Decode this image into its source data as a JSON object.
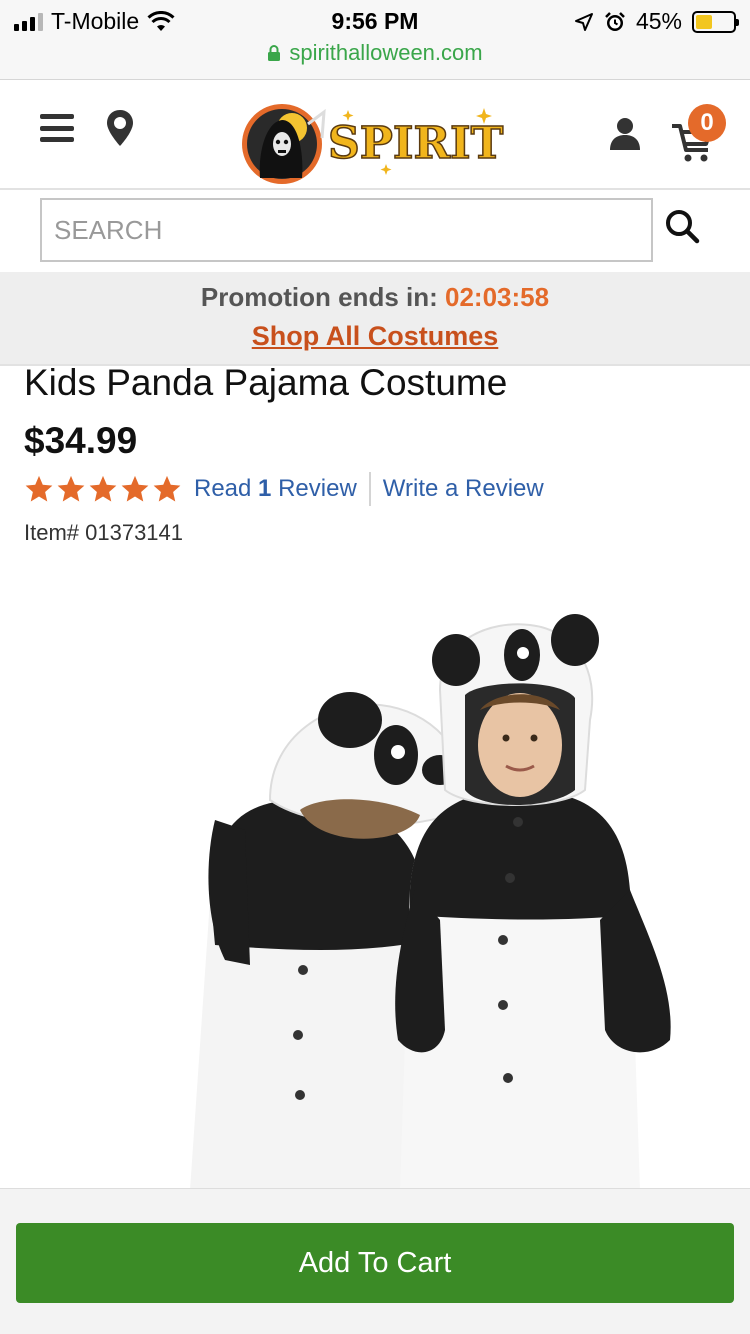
{
  "status_bar": {
    "carrier": "T-Mobile",
    "time": "9:56 PM",
    "battery": "45%",
    "battery_level": 0.45,
    "url": "spirithalloween.com",
    "icons": [
      "signal-icon",
      "wifi-icon",
      "location-arrow-icon",
      "alarm-icon",
      "battery-icon",
      "lock-icon"
    ]
  },
  "header": {
    "logo_text": "SPIRIT",
    "cart_count": "0",
    "icons": [
      "menu-icon",
      "location-pin-icon",
      "user-icon",
      "cart-icon"
    ]
  },
  "search": {
    "placeholder": "SEARCH",
    "icon": "search-icon"
  },
  "promo": {
    "label": "Promotion ends in:",
    "countdown": "02:03:58",
    "link": "Shop All Costumes"
  },
  "product": {
    "title": "Kids Panda Pajama Costume",
    "price": "$34.99",
    "rating_stars": 5,
    "rating_max": 5,
    "read_prefix": "Read",
    "review_count": "1",
    "review_word": "Review",
    "write_review": "Write a Review",
    "item_number": "Item# 01373141"
  },
  "cta": {
    "add_to_cart": "Add To Cart"
  },
  "colors": {
    "accent_orange": "#e46a2a",
    "link_blue": "#2f5fa8",
    "cart_green": "#3b8b26",
    "url_green": "#3aa64a"
  }
}
